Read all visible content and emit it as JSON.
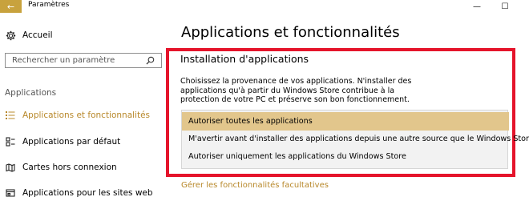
{
  "window": {
    "title": "Paramètres",
    "back_glyph": "←",
    "minimize_glyph": "—",
    "maximize_glyph": "☐"
  },
  "sidebar": {
    "home_label": "Accueil",
    "search_placeholder": "Rechercher un paramètre",
    "section_heading": "Applications",
    "items": [
      {
        "label": "Applications et fonctionnalités",
        "icon": "list-icon",
        "active": true
      },
      {
        "label": "Applications par défaut",
        "icon": "default-apps-icon",
        "active": false
      },
      {
        "label": "Cartes hors connexion",
        "icon": "map-icon",
        "active": false
      },
      {
        "label": "Applications pour les sites web",
        "icon": "web-apps-icon",
        "active": false
      }
    ]
  },
  "main": {
    "title": "Applications et fonctionnalités",
    "install_heading": "Installation d'applications",
    "description": "Choisissez la provenance de vos applications. N'installer des applications qu'à partir du Windows Store contribue à la protection de votre PC et préserve son bon fonctionnement.",
    "dropdown_options": [
      "Autoriser toutes les applications",
      "M'avertir avant d'installer des applications depuis une autre source que le Windows Store",
      "Autoriser uniquement les applications du Windows Store"
    ],
    "selected_option": "Autoriser toutes les applications",
    "manage_link": "Gérer les fonctionnalités facultatives"
  },
  "colors": {
    "accent": "#b8882a",
    "selected_option_bg": "#e2c68c",
    "highlight_border": "#e5142b"
  }
}
